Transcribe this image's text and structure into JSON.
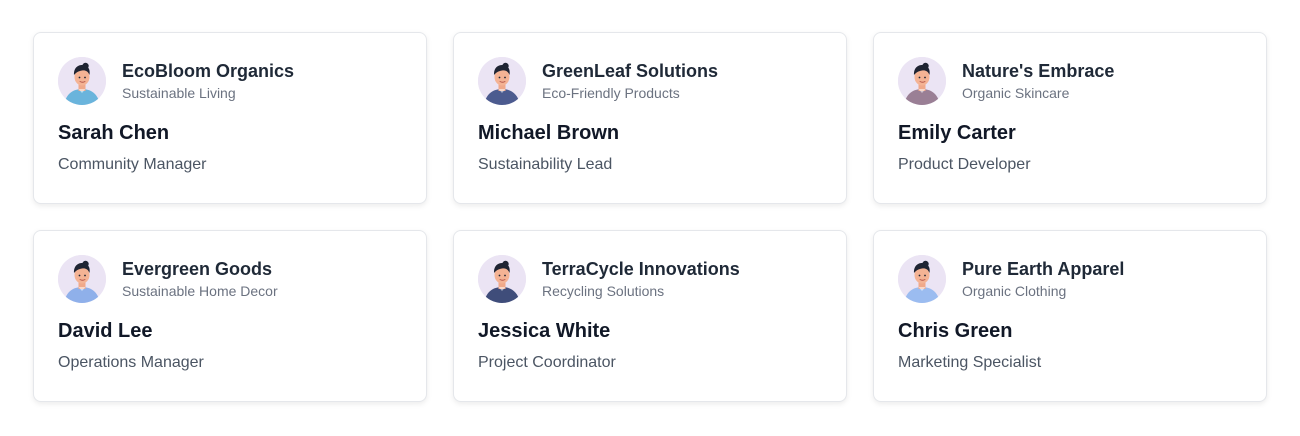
{
  "cards": [
    {
      "company": "EcoBloom Organics",
      "category": "Sustainable Living",
      "name": "Sarah Chen",
      "role": "Community Manager",
      "avatar_icon": "person-avatar-icon",
      "shirt": "#6ab4dc",
      "hair": "#1f2433",
      "bg": "#ebe4f4"
    },
    {
      "company": "GreenLeaf Solutions",
      "category": "Eco-Friendly Products",
      "name": "Michael Brown",
      "role": "Sustainability Lead",
      "avatar_icon": "person-avatar-icon",
      "shirt": "#4c5b8f",
      "hair": "#1f2433",
      "bg": "#ebe4f4"
    },
    {
      "company": "Nature's Embrace",
      "category": "Organic Skincare",
      "name": "Emily Carter",
      "role": "Product Developer",
      "avatar_icon": "person-avatar-icon",
      "shirt": "#9a7f95",
      "hair": "#1f2433",
      "bg": "#ebe4f4"
    },
    {
      "company": "Evergreen Goods",
      "category": "Sustainable Home Decor",
      "name": "David Lee",
      "role": "Operations Manager",
      "avatar_icon": "person-avatar-icon",
      "shirt": "#8fb0ea",
      "hair": "#1f2433",
      "bg": "#ebe4f4"
    },
    {
      "company": "TerraCycle Innovations",
      "category": "Recycling Solutions",
      "name": "Jessica White",
      "role": "Project Coordinator",
      "avatar_icon": "person-avatar-icon",
      "shirt": "#3f4d7a",
      "hair": "#1f2433",
      "bg": "#ebe4f4"
    },
    {
      "company": "Pure Earth Apparel",
      "category": "Organic Clothing",
      "name": "Chris Green",
      "role": "Marketing Specialist",
      "avatar_icon": "person-avatar-icon",
      "shirt": "#9bbcf0",
      "hair": "#1f2433",
      "bg": "#ebe4f4"
    }
  ]
}
